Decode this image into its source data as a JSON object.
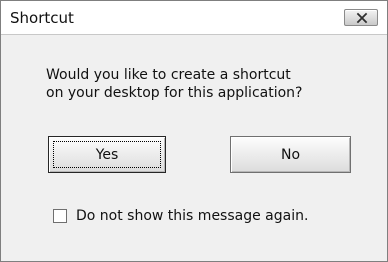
{
  "window": {
    "title": "Shortcut",
    "close_icon": "close-icon"
  },
  "dialog": {
    "message_lines": [
      "Would you like to create a shortcut",
      "on your desktop for this application?"
    ],
    "yes_label": "Yes",
    "no_label": "No",
    "checkbox": {
      "label": "Do not show this message again.",
      "checked": false
    }
  },
  "colors": {
    "dialog_background": "#f0f0f0",
    "titlebar_background": "#ffffff",
    "button_border": "#707070"
  }
}
